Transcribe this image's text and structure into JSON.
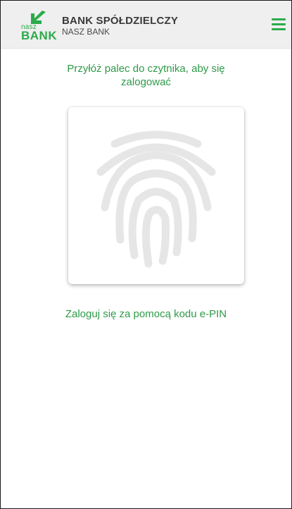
{
  "header": {
    "logo": {
      "small_text": "nasz",
      "big_text": "BANK",
      "icon": "arrow-down-left-icon",
      "brand_color": "#2bab4a"
    },
    "title": "BANK SPÓŁDZIELCZY",
    "subtitle": "NASZ BANK",
    "menu_icon": "hamburger-menu-icon"
  },
  "main": {
    "prompt": "Przyłóż palec do czytnika, aby się zalogować",
    "fingerprint_icon": "fingerprint-icon",
    "epin_link": "Zaloguj się za pomocą kodu e-PIN"
  },
  "colors": {
    "accent": "#2bab4a",
    "text_green": "#2e9a47",
    "header_bg": "#efefef",
    "fingerprint_gray": "#e6e6e6"
  }
}
